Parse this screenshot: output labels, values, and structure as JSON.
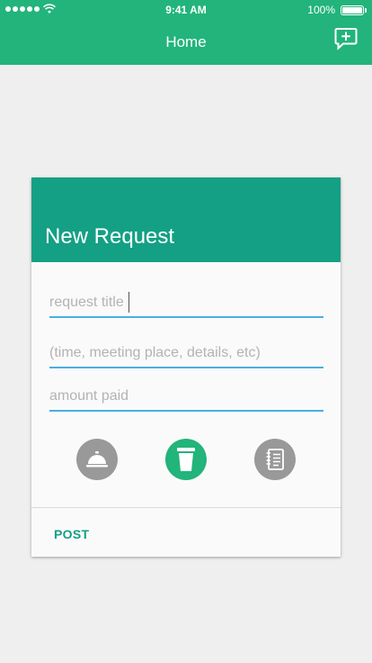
{
  "status_bar": {
    "time": "9:41 AM",
    "battery_percent": "100%"
  },
  "nav": {
    "title": "Home",
    "right_icon": "new-message-icon"
  },
  "card": {
    "title": "New Request",
    "fields": {
      "title_placeholder": "request title",
      "details_placeholder": "(time, meeting place, details, etc)",
      "amount_placeholder": "amount paid"
    },
    "categories": [
      {
        "icon": "service-bell-icon",
        "active": false
      },
      {
        "icon": "coffee-cup-icon",
        "active": true
      },
      {
        "icon": "notebook-icon",
        "active": false
      }
    ],
    "post_label": "POST"
  },
  "colors": {
    "primary": "#22b47a",
    "card_header": "#14a085",
    "field_underline": "#4aaee5",
    "inactive_icon": "#999999"
  }
}
